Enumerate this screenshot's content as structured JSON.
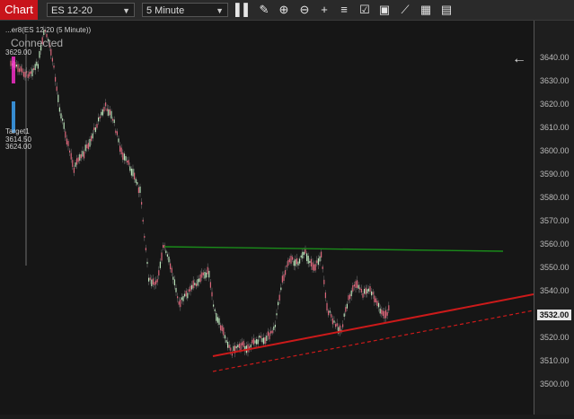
{
  "toolbar": {
    "chart_tab": "Chart",
    "instrument": "ES 12-20",
    "interval": "5 Minute",
    "icons": [
      "bars-icon",
      "pencil-icon",
      "zoom-in-icon",
      "zoom-out-icon",
      "crosshair-icon",
      "properties-icon",
      "template-icon",
      "strategy-icon",
      "drawing-icon",
      "data-box-icon",
      "indicator-icon"
    ]
  },
  "chart": {
    "strategy_label": "...er8(ES 12-20 (5 Minute))",
    "strategy_status": "Connected",
    "order_labels": [
      "3629.00",
      "Target1",
      "3614.50",
      "3624.00"
    ],
    "back_icon": "left-arrow-icon"
  },
  "price_axis": {
    "ticks": [
      "3640.00",
      "3630.00",
      "3620.00",
      "3610.00",
      "3600.00",
      "3590.00",
      "3580.00",
      "3570.00",
      "3560.00",
      "3550.00",
      "3540.00",
      "3530.00",
      "3520.00",
      "3510.00",
      "3500.00"
    ],
    "last_price": "3532.00"
  },
  "colors": {
    "accent": "#c8141b",
    "up": "#b9e3b9",
    "down": "#d9667a",
    "horizontal_line": "#1a8c1a",
    "trend_line": "#cc1a1a"
  }
}
